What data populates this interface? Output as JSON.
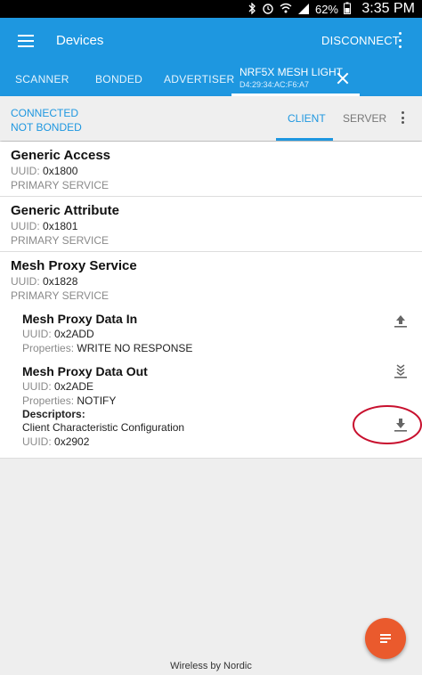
{
  "status_bar": {
    "battery": "62%",
    "time": "3:35 PM"
  },
  "appbar": {
    "title": "Devices",
    "disconnect_label": "DISCONNECT"
  },
  "tabs": {
    "scanner": "SCANNER",
    "bonded": "BONDED",
    "advertiser": "ADVERTISER",
    "device_name": "NRF5X MESH LIGHT",
    "device_address": "D4:29:34:AC:F6:A7"
  },
  "connection": {
    "state": "CONNECTED",
    "bond_state": "NOT BONDED",
    "client_tab": "CLIENT",
    "server_tab": "SERVER"
  },
  "services": [
    {
      "name": "Generic Access",
      "uuid_label": "UUID:",
      "uuid": "0x1800",
      "type": "PRIMARY SERVICE"
    },
    {
      "name": "Generic Attribute",
      "uuid_label": "UUID:",
      "uuid": "0x1801",
      "type": "PRIMARY SERVICE"
    },
    {
      "name": "Mesh Proxy Service",
      "uuid_label": "UUID:",
      "uuid": "0x1828",
      "type": "PRIMARY SERVICE"
    }
  ],
  "characteristics": [
    {
      "name": "Mesh Proxy Data In",
      "uuid_label": "UUID:",
      "uuid": "0x2ADD",
      "properties_label": "Properties:",
      "properties": "WRITE NO RESPONSE",
      "action_icon": "upload-icon"
    },
    {
      "name": "Mesh Proxy Data Out",
      "uuid_label": "UUID:",
      "uuid": "0x2ADE",
      "properties_label": "Properties:",
      "properties": "NOTIFY",
      "action_icon": "notify-icon",
      "descriptors_label": "Descriptors:",
      "descriptor": {
        "name": "Client Characteristic Configuration",
        "uuid_label": "UUID:",
        "uuid": "0x2902",
        "action_icon": "download-icon"
      }
    }
  ],
  "footer": "Wireless by Nordic",
  "colors": {
    "primary": "#1e97e0",
    "fab": "#ea5a2d",
    "annotation": "#c8102e"
  }
}
